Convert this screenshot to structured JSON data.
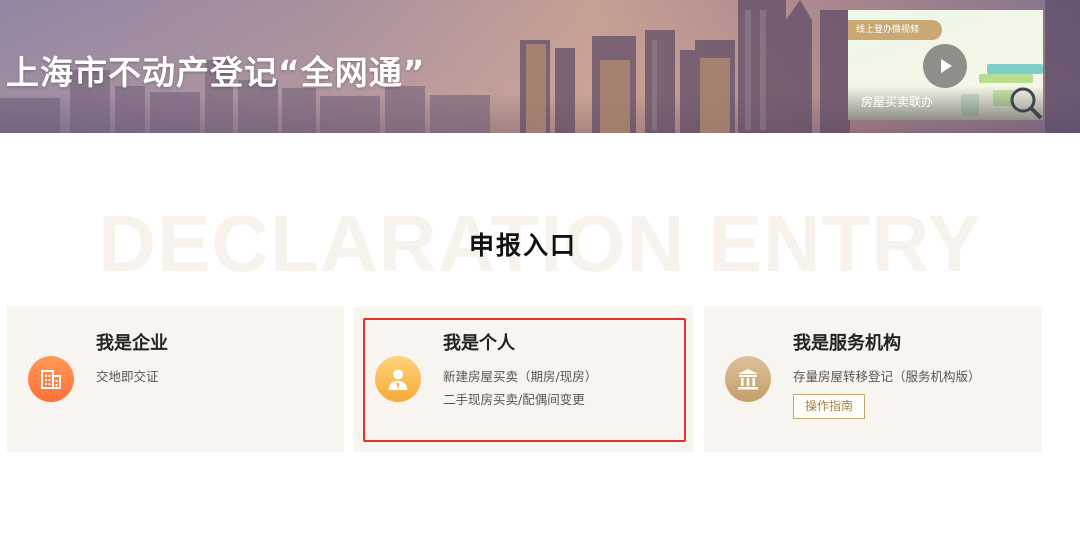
{
  "banner": {
    "title": "上海市不动产登记“全网通”"
  },
  "video": {
    "tag": "线上登办微视频",
    "caption": "房屋买卖联办",
    "icon": "play-icon"
  },
  "section": {
    "watermark": "DECLARATION ENTRY",
    "title": "申报入口"
  },
  "cards": [
    {
      "title": "我是企业",
      "icon": "building-icon",
      "lines": [
        "交地即交证"
      ]
    },
    {
      "title": "我是个人",
      "icon": "person-icon",
      "lines": [
        "新建房屋买卖（期房/现房）",
        "二手现房买卖/配偶间变更"
      ],
      "highlighted": true
    },
    {
      "title": "我是服务机构",
      "icon": "institution-icon",
      "lines": [
        "存量房屋转移登记（服务机构版）"
      ],
      "button": "操作指南"
    }
  ],
  "colors": {
    "highlight": "#e53129",
    "card_bg": "#f8f5f0",
    "enterprise_icon": "#ff7a42",
    "personal_icon": "#f8b24a",
    "institution_icon": "#c9a676"
  }
}
